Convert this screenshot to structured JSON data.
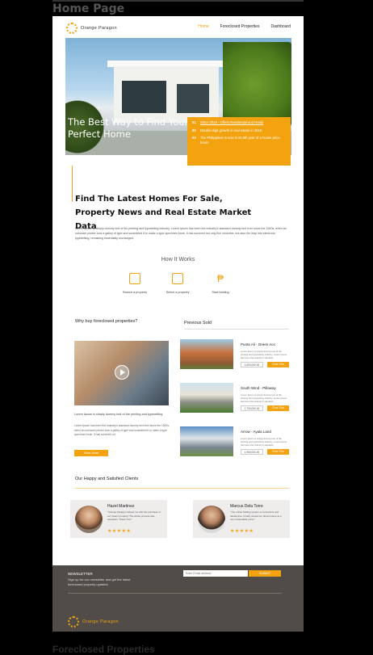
{
  "frame": {
    "title": "Home Page",
    "title_bottom": "Foreclosed Properties"
  },
  "brand": {
    "name": "Orange Paragon",
    "accent": "#f2a30f"
  },
  "nav": {
    "items": [
      "Home",
      "Foreclosed Properties",
      "Dashboard"
    ],
    "active": "Home"
  },
  "hero": {
    "title": "The Best Way to Find Your Perfect Home",
    "facts": [
      {
        "num": "01",
        "text": "Since 2019 - Offers Residential and Retail"
      },
      {
        "num": "02",
        "text": "Double-digit growth in real estate in 2019"
      },
      {
        "num": "03",
        "text": "The Philippines is now in its 8th year of a house price boom"
      }
    ]
  },
  "latest": {
    "title": "Find The Latest Homes For Sale, Property News and Real Estate Market Data",
    "body": "Lorem Ipsum is simply dummy text of the printing and typesetting industry. Lorem Ipsum has been the industry's standard dummy text ever since the 1500s, when an unknown printer took a galley of type and scrambled it to make a type specimen book. It has survived not only five centuries, but also the leap into electronic typesetting, remaining essentially unchanged."
  },
  "how": {
    "title": "How It Works",
    "steps": [
      {
        "label": "Search a property",
        "icon": "search-copy-icon"
      },
      {
        "label": "Select a property",
        "icon": "clipboard-check-icon"
      },
      {
        "label": "Start bidding",
        "icon": "peso-icon"
      }
    ]
  },
  "why": {
    "title": "Why buy foreclosed properties?",
    "lead": "Lorem Ipsum is simply dummy text of the printing and typesetting",
    "body": "Lorem Ipsum has been the industry's standard dummy text ever since the 1500s, when an unknown printer took a galley of type and scrambled it to make a type specimen book. It has survived not",
    "button": "View More"
  },
  "previous": {
    "title": "Previous Sold",
    "items": [
      {
        "name": "Punta Ali - Green Acs",
        "desc": "Lorem Ipsum is simply dummy text of the printing and typesetting industry. Lorem Ipsum has been the industry's standard",
        "price": "1,600,000.00",
        "button": "Chat This"
      },
      {
        "name": "South Wind - Pillaway",
        "desc": "Lorem Ipsum is simply dummy text of the printing and typesetting industry. Lorem Ipsum has been the industry's standard",
        "price": "1,700,000.00",
        "button": "Chat This"
      },
      {
        "name": "Arrow - Ayala Land",
        "desc": "Lorem Ipsum is simply dummy text of the printing and typesetting industry. Lorem Ipsum has been the industry's standard",
        "price": "1,900,000.00",
        "button": "Chat This"
      }
    ]
  },
  "clients": {
    "title": "Our Happy and Satisfied Clients",
    "cards": [
      {
        "name": "Hazel Martinez",
        "text": "\"Orange Paragon helped me with the purchase of our dream property! The whole process was seamless. Thank You!\"",
        "stars": "★★★★★"
      },
      {
        "name": "Marcus Dela Torre",
        "text": "\"The online bidding system is convenient and hassle-free. Finally owned our dream home at a very reasonable price!\"",
        "stars": "★★★★★"
      }
    ]
  },
  "footer": {
    "newsletter": "NEWSLETTER",
    "newsletter_text": "Sign up for our newsletter and get the latest foreclosed property updates",
    "email_placeholder": "Enter Email address",
    "submit": "SUBMIT",
    "brand": "Orange Paragon"
  }
}
